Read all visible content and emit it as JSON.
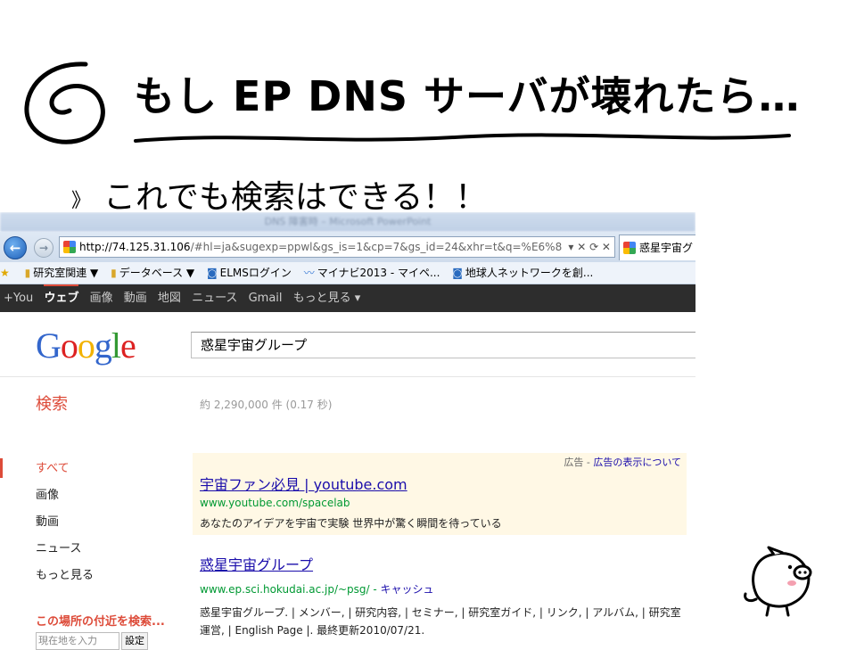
{
  "slide": {
    "title": "もし EP DNS サーバが壊れたら…",
    "bullet_mark": "》",
    "bullet": "これでも検索はできる！！"
  },
  "browser": {
    "window_title": "DNS 障害時 – Microsoft PowerPoint",
    "address_host": "http://74.125.31.106",
    "address_rest": "/#hl=ja&sugexp=ppwl&gs_is=1&cp=7&gs_id=24&xhr=t&q=%E6%8",
    "address_controls": "▾ ✕ ⟳ ✕",
    "tab_title": "惑星宇宙グ",
    "favorites": [
      {
        "icon": "folder-icon",
        "label": "研究室関連 ▼"
      },
      {
        "icon": "folder-icon",
        "label": "データベース ▼"
      },
      {
        "icon": "page-icon",
        "label": "ELMSログイン"
      },
      {
        "icon": "chart-icon",
        "label": "マイナビ2013 - マイペ..."
      },
      {
        "icon": "page-icon",
        "label": "地球人ネットワークを創..."
      }
    ]
  },
  "google": {
    "bar": [
      "+You",
      "ウェブ",
      "画像",
      "動画",
      "地図",
      "ニュース",
      "Gmail",
      "もっと見る ▾"
    ],
    "logo": "Google",
    "query": "惑星宇宙グループ",
    "search_label": "検索",
    "stats": "約 2,290,000 件 (0.17 秒)",
    "sidebar": [
      "すべて",
      "画像",
      "動画",
      "ニュース",
      "もっと見る"
    ],
    "near_title": "この場所の付近を検索...",
    "loc_placeholder": "現在地を入力",
    "loc_button": "設定",
    "ad": {
      "label": "広告 - ",
      "label_link": "広告の表示について",
      "title": "宇宙ファン必見 | youtube.com",
      "url": "www.youtube.com/spacelab",
      "snippet": "あなたのアイデアを宇宙で実験 世界中が驚く瞬間を待っている"
    },
    "result": {
      "title": "惑星宇宙グループ",
      "url": "www.ep.sci.hokudai.ac.jp/~psg/ - ",
      "cache": "キャッシュ",
      "snippet": "惑星宇宙グループ. | メンバー, | 研究内容, | セミナー, | 研究室ガイド, | リンク, | アルバム, | 研究室運営, | English Page |. 最終更新2010/07/21."
    }
  },
  "logo_colors": [
    "#3366cc",
    "#dd2222",
    "#f2b200",
    "#3366cc",
    "#339933",
    "#dd2222"
  ]
}
